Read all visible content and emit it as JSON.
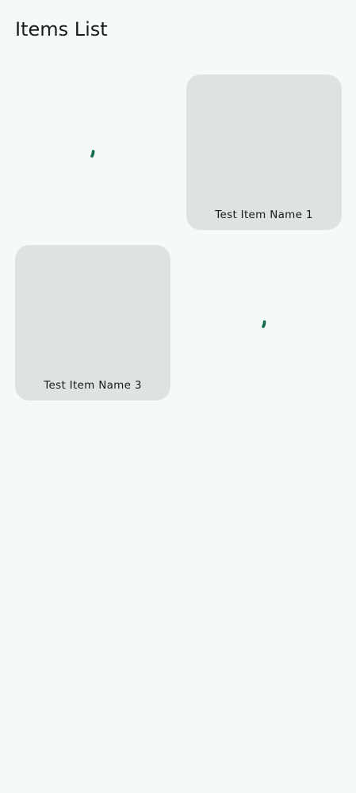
{
  "header": {
    "title": "Items List"
  },
  "items": [
    {
      "state": "loading",
      "icon": "progress-spinner-icon"
    },
    {
      "state": "loaded",
      "name": "Test Item Name 1"
    },
    {
      "state": "loaded",
      "name": "Test Item Name 3"
    },
    {
      "state": "loading",
      "icon": "progress-spinner-icon"
    }
  ],
  "colors": {
    "background": "#f4faf6",
    "card": "#dee3df",
    "spinner": "#136b4f",
    "text": "#191c1b"
  }
}
